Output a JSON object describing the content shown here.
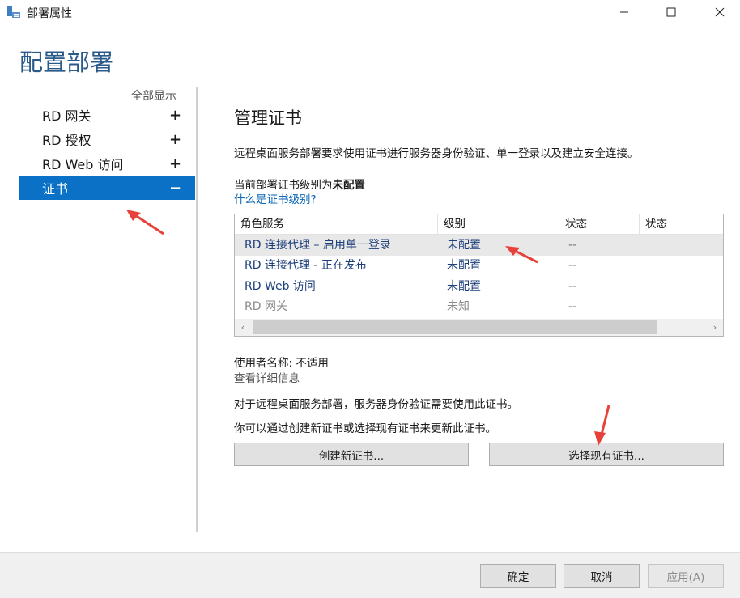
{
  "window": {
    "title": "部署属性",
    "controls": {
      "minimize": "—",
      "maximize": "☐",
      "close": "✕"
    }
  },
  "page": {
    "heading": "配置部署"
  },
  "nav": {
    "show_all": "全部显示",
    "items": [
      {
        "label": "RD 网关",
        "sign": "+"
      },
      {
        "label": "RD 授权",
        "sign": "+"
      },
      {
        "label": "RD Web 访问",
        "sign": "+"
      },
      {
        "label": "证书",
        "sign": "−",
        "active": true
      }
    ]
  },
  "content": {
    "title": "管理证书",
    "description": "远程桌面服务部署要求使用证书进行服务器身份验证、单一登录以及建立安全连接。",
    "level_prefix": "当前部署证书级别为",
    "level_value": "未配置",
    "level_link": "什么是证书级别?",
    "grid": {
      "headers": [
        "角色服务",
        "级别",
        "状态",
        "状态"
      ],
      "rows": [
        {
          "role": "RD 连接代理 – 启用单一登录",
          "level": "未配置",
          "status": "--",
          "selected": true
        },
        {
          "role": "RD 连接代理 - 正在发布",
          "level": "未配置",
          "status": "--"
        },
        {
          "role": "RD Web 访问",
          "level": "未配置",
          "status": "--"
        },
        {
          "role": "RD 网关",
          "level": "未知",
          "status": "--",
          "dim": true
        }
      ]
    },
    "user_line": "使用者名称: 不适用",
    "detail_link": "查看详细信息",
    "need_line": "对于远程桌面服务部署，服务器身份验证需要使用此证书。",
    "update_line": "你可以通过创建新证书或选择现有证书来更新此证书。",
    "create_button": "创建新证书...",
    "select_button": "选择现有证书..."
  },
  "footer": {
    "ok": "确定",
    "cancel": "取消",
    "apply": "应用(A)"
  },
  "colors": {
    "accent": "#0a71c6",
    "heading": "#2a5a8a",
    "link": "#0a66b8",
    "annotation_arrow": "#e8413a"
  }
}
